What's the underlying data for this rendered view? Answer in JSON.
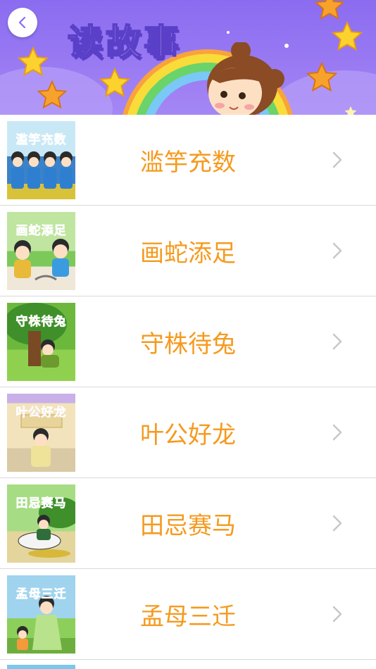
{
  "header": {
    "title": "读故事",
    "back_icon": "chevron-left-icon"
  },
  "stories": [
    {
      "label": "滥竽充数",
      "thumb_title": "滥竽充数",
      "thumb_bg": "#c9e8f6",
      "title_color": "#27a9e1"
    },
    {
      "label": "画蛇添足",
      "thumb_title": "画蛇添足",
      "thumb_bg": "#bfe5a0",
      "title_color": "#e8489a"
    },
    {
      "label": "守株待兔",
      "thumb_title": "守株待兔",
      "thumb_bg": "#7ec24a",
      "title_color": "#f4d23a"
    },
    {
      "label": "叶公好龙",
      "thumb_title": "叶公好龙",
      "thumb_bg": "#f2e3bc",
      "title_color": "#b56ad8"
    },
    {
      "label": "田忌赛马",
      "thumb_title": "田忌赛马",
      "thumb_bg": "#a6dd84",
      "title_color": "#2aa7d8"
    },
    {
      "label": "孟母三迁",
      "thumb_title": "孟母三迁",
      "thumb_bg": "#9fd3ee",
      "title_color": "#f4c73a"
    }
  ],
  "colors": {
    "accent_text": "#f59a1e",
    "banner": "#8b6cf0",
    "chevron": "#c7c7cc"
  }
}
